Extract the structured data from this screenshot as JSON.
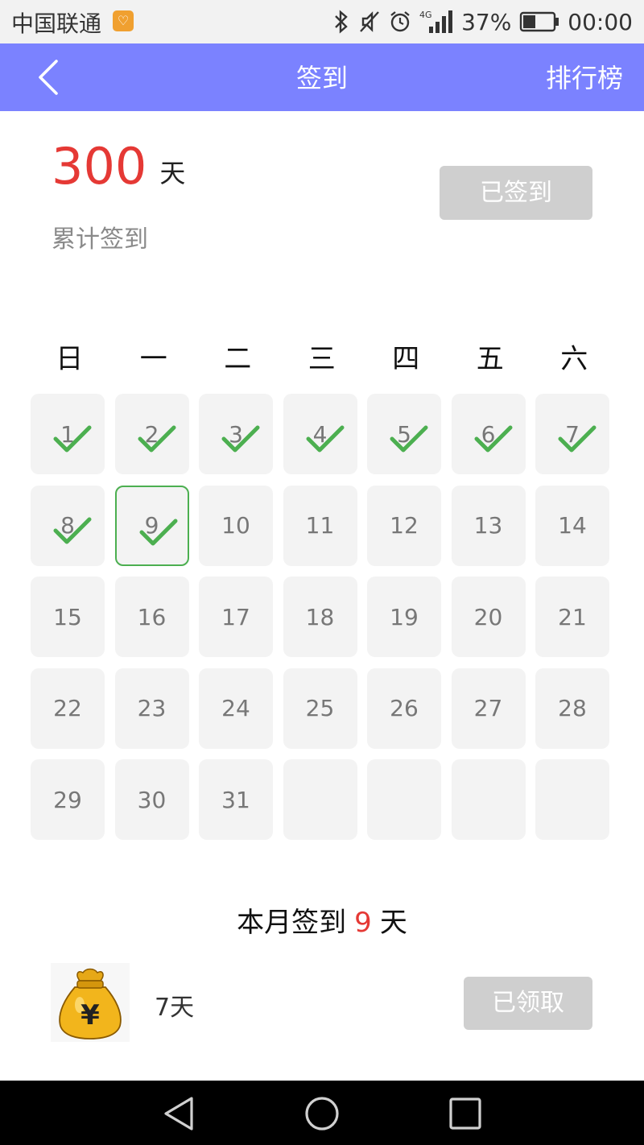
{
  "status_bar": {
    "carrier": "中国联通",
    "battery_percent": "37%",
    "network": "4G",
    "time": "00:00",
    "icons": [
      "bluetooth-icon",
      "mute-icon",
      "alarm-icon",
      "signal-icon",
      "battery-icon"
    ]
  },
  "header": {
    "title": "签到",
    "rank_label": "排行榜",
    "bg_color": "#7b82ff"
  },
  "summary": {
    "total_days": "300",
    "unit": "天",
    "label": "累计签到",
    "signed_button": "已签到"
  },
  "calendar": {
    "weekdays": [
      "日",
      "一",
      "二",
      "三",
      "四",
      "五",
      "六"
    ],
    "days": [
      {
        "n": "1",
        "signed": true
      },
      {
        "n": "2",
        "signed": true
      },
      {
        "n": "3",
        "signed": true
      },
      {
        "n": "4",
        "signed": true
      },
      {
        "n": "5",
        "signed": true
      },
      {
        "n": "6",
        "signed": true
      },
      {
        "n": "7",
        "signed": true
      },
      {
        "n": "8",
        "signed": true
      },
      {
        "n": "9",
        "signed": true,
        "today": true
      },
      {
        "n": "10"
      },
      {
        "n": "11"
      },
      {
        "n": "12"
      },
      {
        "n": "13"
      },
      {
        "n": "14"
      },
      {
        "n": "15"
      },
      {
        "n": "16"
      },
      {
        "n": "17"
      },
      {
        "n": "18"
      },
      {
        "n": "19"
      },
      {
        "n": "20"
      },
      {
        "n": "21"
      },
      {
        "n": "22"
      },
      {
        "n": "23"
      },
      {
        "n": "24"
      },
      {
        "n": "25"
      },
      {
        "n": "26"
      },
      {
        "n": "27"
      },
      {
        "n": "28"
      },
      {
        "n": "29"
      },
      {
        "n": "30"
      },
      {
        "n": "31"
      },
      {
        "n": ""
      },
      {
        "n": ""
      },
      {
        "n": ""
      },
      {
        "n": ""
      }
    ],
    "accent_color": "#4caf50"
  },
  "month": {
    "prefix": "本月签到",
    "count": "9",
    "unit": "天"
  },
  "reward": {
    "icon": "money-bag-icon",
    "days_label": "7天",
    "claimed_button": "已领取"
  },
  "nav": {
    "icons": [
      "back-triangle-icon",
      "home-circle-icon",
      "recents-square-icon"
    ]
  }
}
